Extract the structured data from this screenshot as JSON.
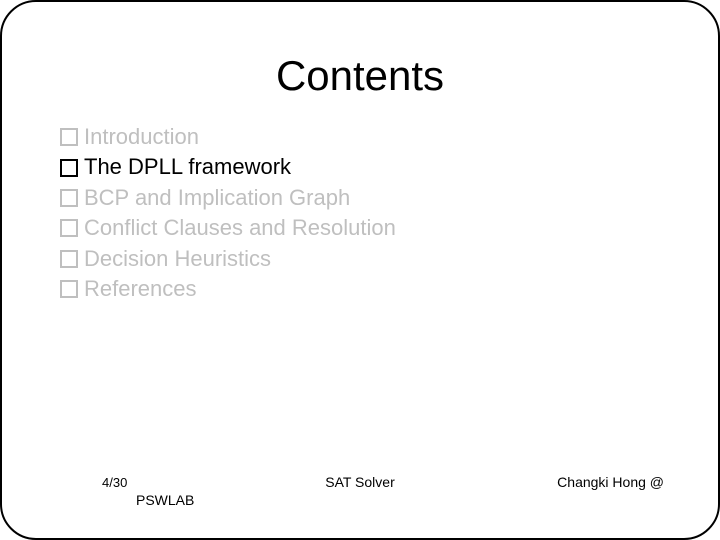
{
  "title": "Contents",
  "items": [
    {
      "label": "Introduction",
      "dimmed": true
    },
    {
      "label": "The DPLL framework",
      "dimmed": false
    },
    {
      "label": "BCP and Implication Graph",
      "dimmed": true
    },
    {
      "label": "Conflict Clauses and Resolution",
      "dimmed": true
    },
    {
      "label": "Decision Heuristics",
      "dimmed": true
    },
    {
      "label": "References",
      "dimmed": true
    }
  ],
  "footer": {
    "page": "4/30",
    "lab": "PSWLAB",
    "center": "SAT Solver",
    "right": "Changki Hong @"
  }
}
